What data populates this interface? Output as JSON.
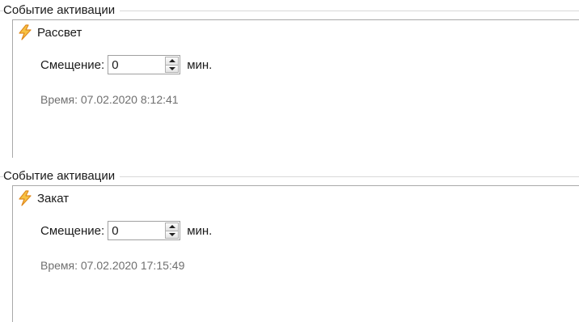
{
  "panels": [
    {
      "group_title": "Событие активации",
      "event_icon": "lightning-bolt-icon",
      "event_name": "Рассвет",
      "offset_label": "Смещение:",
      "offset_value": "0",
      "offset_unit": "мин.",
      "time_text": "Время: 07.02.2020 8:12:41"
    },
    {
      "group_title": "Событие активации",
      "event_icon": "lightning-bolt-icon",
      "event_name": "Закат",
      "offset_label": "Смещение:",
      "offset_value": "0",
      "offset_unit": "мин.",
      "time_text": "Время: 07.02.2020 17:15:49"
    }
  ],
  "colors": {
    "bolt_fill": "#f7c243",
    "bolt_stroke": "#e08a1e",
    "time_text": "#6f6f6f",
    "border": "#a9a9a9"
  }
}
